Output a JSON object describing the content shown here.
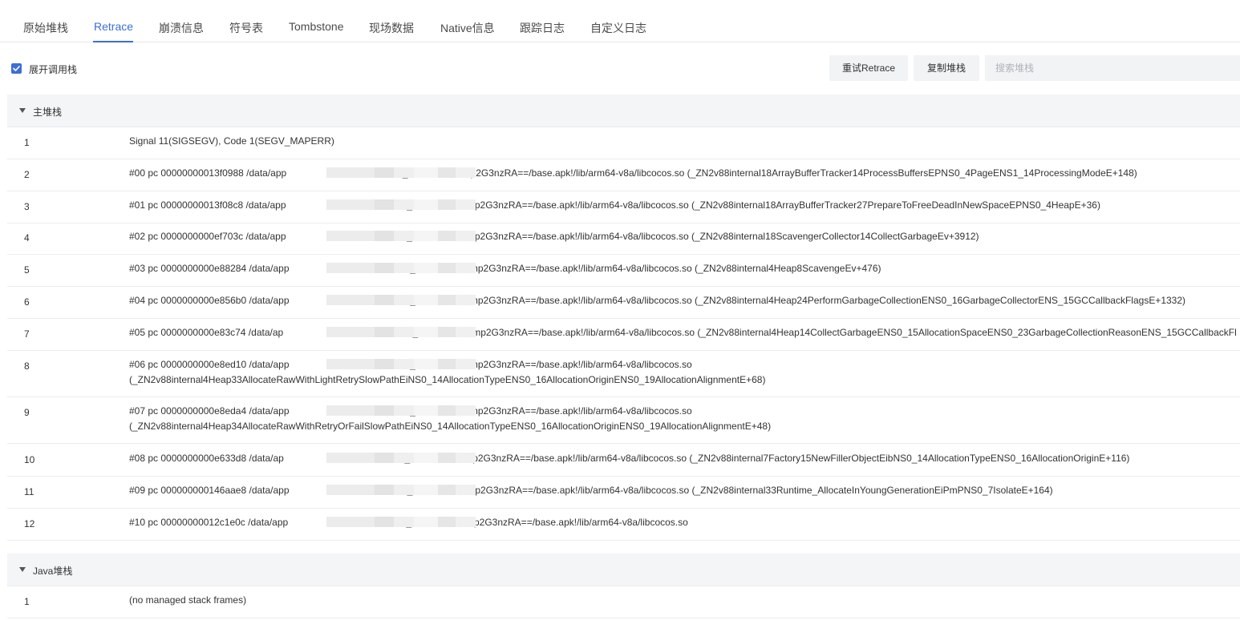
{
  "tabs": [
    "原始堆栈",
    "Retrace",
    "崩溃信息",
    "符号表",
    "Tombstone",
    "现场数据",
    "Native信息",
    "跟踪日志",
    "自定义日志"
  ],
  "toolbar": {
    "expand_label": "展开调用栈",
    "retry_label": "重试Retrace",
    "copy_label": "复制堆栈",
    "search_placeholder": "搜索堆栈"
  },
  "main_stack": {
    "title": "主堆栈",
    "rows": [
      {
        "index": "1",
        "lines": [
          "Signal 11(SIGSEGV), Code 1(SEGV_MAPERR)"
        ]
      },
      {
        "index": "2",
        "lines": [
          "#00 pc 00000000013f0988 /data/app                                        -T_kCZCW8lXHmp2G3nzRA==/base.apk!/lib/arm64-v8a/libcocos.so (_ZN2v88internal18ArrayBufferTracker14ProcessBuffersEPNS0_4PageENS1_14ProcessingModeE+148)"
        ]
      },
      {
        "index": "3",
        "lines": [
          "#01 pc 00000000013f08c8 /data/app                                        k-T_kCZCW8lXHmp2G3nzRA==/base.apk!/lib/arm64-v8a/libcocos.so (_ZN2v88internal18ArrayBufferTracker27PrepareToFreeDeadInNewSpaceEPNS0_4HeapE+36)"
        ]
      },
      {
        "index": "4",
        "lines": [
          "#02 pc 0000000000ef703c /data/app                                        k-T_kCZCW8lXHmp2G3nzRA==/base.apk!/lib/arm64-v8a/libcocos.so (_ZN2v88internal18ScavengerCollector14CollectGarbageEv+3912)"
        ]
      },
      {
        "index": "5",
        "lines": [
          "#03 pc 0000000000e88284 /data/app                                        k-T_kCZCW8lXHmp2G3nzRA==/base.apk!/lib/arm64-v8a/libcocos.so (_ZN2v88internal4Heap8ScavengeEv+476)"
        ]
      },
      {
        "index": "6",
        "lines": [
          "#04 pc 0000000000e856b0 /data/app                                        k-T_kCZCW8lXHmp2G3nzRA==/base.apk!/lib/arm64-v8a/libcocos.so (_ZN2v88internal4Heap24PerformGarbageCollectionENS0_16GarbageCollectorENS_15GCCallbackFlagsE+1332)"
        ]
      },
      {
        "index": "7",
        "lines": [
          "#05 pc 0000000000e83c74 /data/ap                                        2-k-T_kCZCW8lXHmp2G3nzRA==/base.apk!/lib/arm64-v8a/libcocos.so (_ZN2v88internal4Heap14CollectGarbageENS0_15AllocationSpaceENS0_23GarbageCollectionReasonENS_15GCCallbackFl"
        ]
      },
      {
        "index": "8",
        "lines": [
          "#06 pc 0000000000e8ed10 /data/app                                        k-T_kCZCW8lXHmp2G3nzRA==/base.apk!/lib/arm64-v8a/libcocos.so",
          "(_ZN2v88internal4Heap33AllocateRawWithLightRetrySlowPathEiNS0_14AllocationTypeENS0_16AllocationOriginENS0_19AllocationAlignmentE+68)"
        ]
      },
      {
        "index": "9",
        "lines": [
          "#07 pc 0000000000e8eda4 /data/app                                        k-T_kCZCW8lXHmp2G3nzRA==/base.apk!/lib/arm64-v8a/libcocos.so",
          "(_ZN2v88internal4Heap34AllocateRawWithRetryOrFailSlowPathEiNS0_14AllocationTypeENS0_16AllocationOriginENS0_19AllocationAlignmentE+48)"
        ]
      },
      {
        "index": "10",
        "lines": [
          "#08 pc 0000000000e633d8 /data/ap                                        k-T_kCZCW8lXHmp2G3nzRA==/base.apk!/lib/arm64-v8a/libcocos.so (_ZN2v88internal7Factory15NewFillerObjectEibNS0_14AllocationTypeENS0_16AllocationOriginE+116)"
        ]
      },
      {
        "index": "11",
        "lines": [
          "#09 pc 000000000146aae8 /data/app                                          T_kCZCW8lXHmp2G3nzRA==/base.apk!/lib/arm64-v8a/libcocos.so (_ZN2v88internal33Runtime_AllocateInYoungGenerationEiPmPNS0_7IsolateE+164)"
        ]
      },
      {
        "index": "12",
        "lines": [
          "#10 pc 00000000012c1e0c /data/app                                          T_kCZCW8lXHmp2G3nzRA==/base.apk!/lib/arm64-v8a/libcocos.so"
        ]
      }
    ]
  },
  "java_stack": {
    "title": "Java堆栈",
    "rows": [
      {
        "index": "1",
        "lines": [
          "(no managed stack frames)"
        ]
      }
    ]
  },
  "colors": {
    "accent": "#3c6fd6",
    "section_bg": "#f4f5f6",
    "button_bg": "#f2f3f5"
  }
}
